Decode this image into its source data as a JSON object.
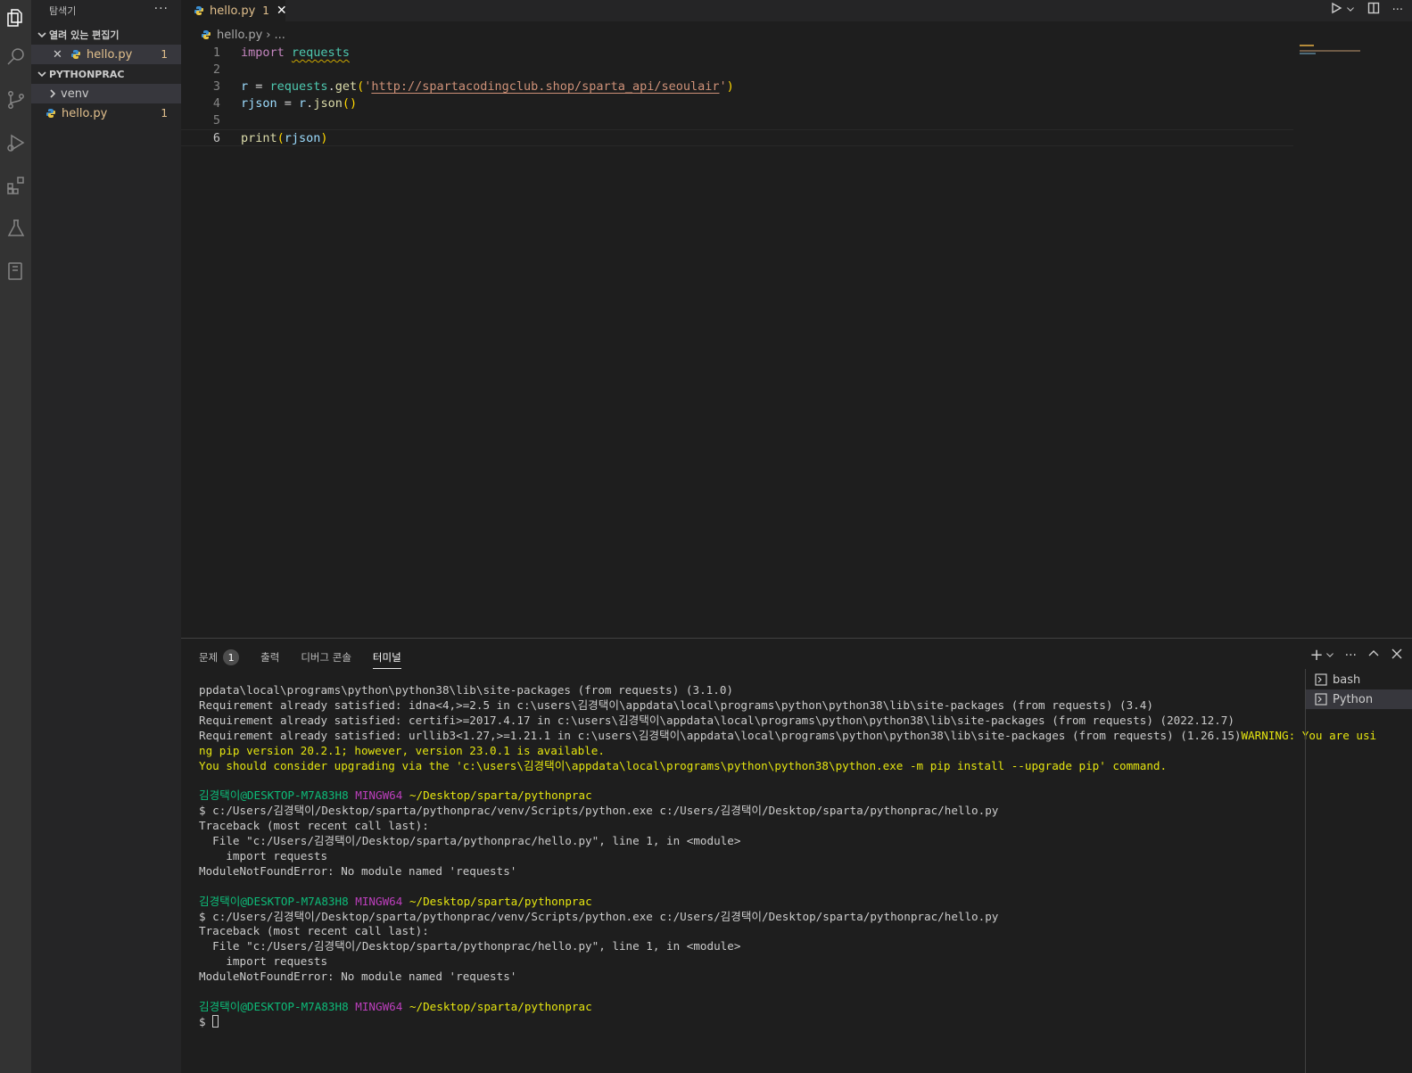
{
  "sidebar": {
    "title": "탐색기",
    "more": "···",
    "open_editors_title": "열려 있는 편집기",
    "open_editor_file": "hello.py",
    "open_editor_badge": "1",
    "project_title": "PYTHONPRAC",
    "folder_venv": "venv",
    "file_hello": "hello.py",
    "file_hello_badge": "1"
  },
  "tab": {
    "label": "hello.py",
    "problem_count": "1",
    "close": "✕",
    "more": "···"
  },
  "breadcrumb": {
    "file": "hello.py",
    "separator": "›",
    "rest": "..."
  },
  "editor": {
    "line_numbers": [
      "1",
      "2",
      "3",
      "4",
      "5",
      "6"
    ],
    "current_line": 6,
    "code": {
      "l1_kw": "import",
      "l1_mod": "requests",
      "l3_r": "r",
      "l3_eq": " = ",
      "l3_mod": "requests",
      "l3_dot": ".",
      "l3_fn": "get",
      "l3_open": "(",
      "l3_q1": "'",
      "l3_url": "http://spartacodingclub.shop/sparta_api/seoulair",
      "l3_q2": "'",
      "l3_close": ")",
      "l4_var": "rjson",
      "l4_eq": " = ",
      "l4_r": "r",
      "l4_dot": ".",
      "l4_fn": "json",
      "l4_parens": "()",
      "l6_fn": "print",
      "l6_open": "(",
      "l6_var": "rjson",
      "l6_close": ")"
    }
  },
  "panel": {
    "tabs": {
      "problems": "문제",
      "problems_count": "1",
      "output": "출력",
      "debug_console": "디버그 콘솔",
      "terminal": "터미널"
    },
    "add": "+",
    "more": "···",
    "terminals": [
      "bash",
      "Python"
    ]
  },
  "terminal": {
    "line1": "ppdata\\local\\programs\\python\\python38\\lib\\site-packages (from requests) (3.1.0)",
    "line2": "Requirement already satisfied: idna<4,>=2.5 in c:\\users\\김경택이\\appdata\\local\\programs\\python\\python38\\lib\\site-packages (from requests) (3.4)",
    "line3": "Requirement already satisfied: certifi>=2017.4.17 in c:\\users\\김경택이\\appdata\\local\\programs\\python\\python38\\lib\\site-packages (from requests) (2022.12.7)",
    "line4a": "Requirement already satisfied: urllib3<1.27,>=1.21.1 in c:\\users\\김경택이\\appdata\\local\\programs\\python\\python38\\lib\\site-packages (from requests) (1.26.15)",
    "line4b": "WARNING: You are usi",
    "line5": "ng pip version 20.2.1; however, version 23.0.1 is available.",
    "line6": "You should consider upgrading via the 'c:\\users\\김경택이\\appdata\\local\\programs\\python\\python38\\python.exe -m pip install --upgrade pip' command.",
    "prompt_user": "김경택이@DESKTOP-M7A83H8",
    "prompt_env": "MINGW64",
    "prompt_path": "~/Desktop/sparta/pythonprac",
    "cmd": "$ c:/Users/김경택이/Desktop/sparta/pythonprac/venv/Scripts/python.exe c:/Users/김경택이/Desktop/sparta/pythonprac/hello.py",
    "tb1": "Traceback (most recent call last):",
    "tb2": "  File \"c:/Users/김경택이/Desktop/sparta/pythonprac/hello.py\", line 1, in <module>",
    "tb3": "    import requests",
    "tb4": "ModuleNotFoundError: No module named 'requests'",
    "final_prompt": "$ "
  },
  "colors": {
    "activity_bar": "#333333",
    "sidebar": "#252526",
    "editor": "#1e1e1e",
    "modified_file": "#e2c08d"
  }
}
